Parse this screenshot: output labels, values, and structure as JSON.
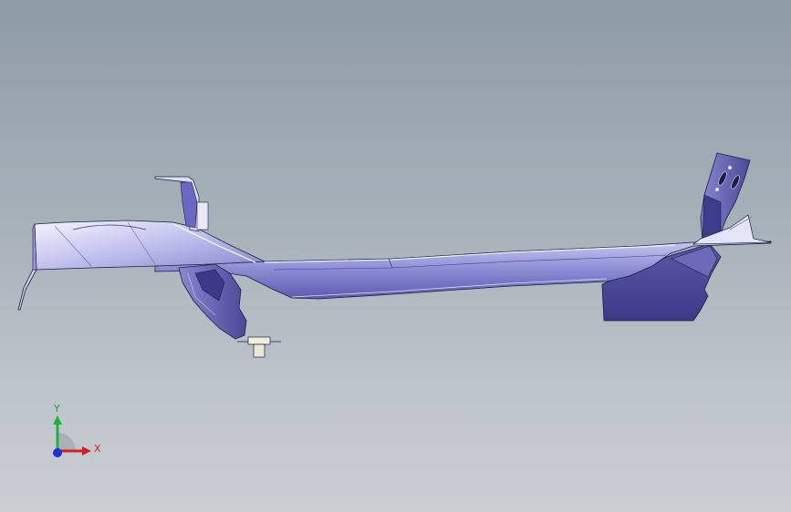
{
  "viewport": {
    "background_top": "#8e9aa6",
    "background_bottom": "#c9ced3"
  },
  "model": {
    "part_color": "#5a58a8",
    "highlight_color": "#e8e8f8",
    "edge_color": "#1e1e40"
  },
  "triad": {
    "x_label": "X",
    "y_label": "Y",
    "x_color": "#d02020",
    "y_color": "#20b040",
    "z_color": "#2030d0"
  }
}
